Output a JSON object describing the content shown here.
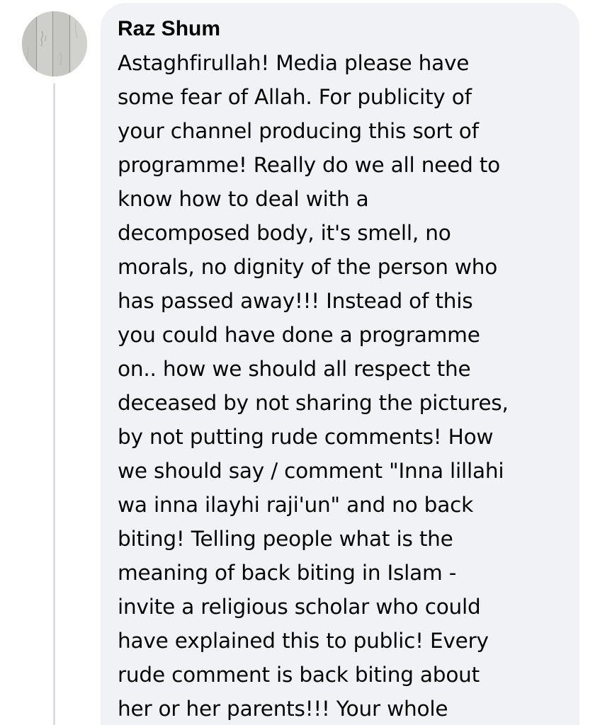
{
  "comment": {
    "author": "Raz Shum",
    "lines": [
      "Astaghfirullah! Media please have",
      "some fear of Allah. For publicity of",
      "your channel producing this sort of",
      "programme! Really do we all need to",
      "know how to deal with a",
      "decomposed body, it's smell, no",
      "morals, no dignity of the person who",
      "has passed away!!! Instead of this",
      "you could have done a programme",
      "on.. how we should all respect the",
      "deceased by not sharing the pictures,",
      "by not putting rude comments! How",
      "we should say / comment \"Inna lillahi",
      "wa inna ilayhi raji'un\" and no back",
      "biting! Telling people what is the",
      "meaning of back biting in Islam -",
      "invite a religious scholar who could",
      "have explained this to public! Every",
      "rude comment is back biting about",
      "her or her parents!!! Your whole"
    ]
  },
  "colors": {
    "bubble_background": "#f0f2f5",
    "text": "#050505",
    "thread_line": "#dadde1"
  },
  "icons": {
    "avatar": "profile-photo-wood"
  }
}
